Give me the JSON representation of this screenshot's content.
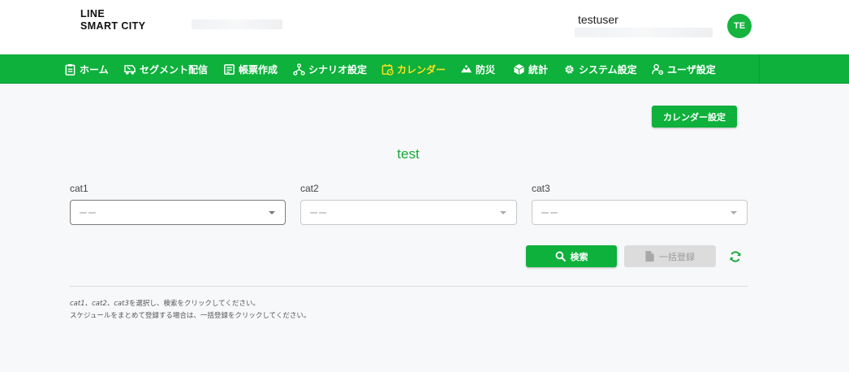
{
  "header": {
    "logo_line1": "LINE",
    "logo_line2": "SMART CITY",
    "username": "testuser",
    "avatar_initials": "TE"
  },
  "nav": {
    "items": [
      {
        "label": "ホーム",
        "icon": "clipboard-icon"
      },
      {
        "label": "セグメント配信",
        "icon": "send-icon"
      },
      {
        "label": "帳票作成",
        "icon": "form-icon"
      },
      {
        "label": "シナリオ設定",
        "icon": "scenario-icon"
      },
      {
        "label": "カレンダー",
        "icon": "calendar-icon",
        "active": true
      },
      {
        "label": "防災",
        "icon": "disaster-icon"
      },
      {
        "label": "統計",
        "icon": "cube-icon"
      },
      {
        "label": "システム設定",
        "icon": "gear-icon"
      },
      {
        "label": "ユーザ設定",
        "icon": "user-gear-icon"
      }
    ],
    "active_color": "#ffe11d",
    "background": "#0db13b"
  },
  "main": {
    "calendar_settings_label": "カレンダー設定",
    "title": "test",
    "fields": [
      {
        "label": "cat1",
        "value": "ーー"
      },
      {
        "label": "cat2",
        "value": "ーー"
      },
      {
        "label": "cat3",
        "value": "ーー"
      }
    ],
    "search_label": "検索",
    "bulk_register_label": "一括登録",
    "help_line1_cats": "cat1、cat2、cat3",
    "help_line1_rest": "を選択し、検索をクリックしてください。",
    "help_line2": "スケジュールをまとめて登録する場合は、一括登録をクリックしてください。"
  },
  "colors": {
    "accent": "#0db13b",
    "title": "#16a838",
    "disabled": "#dcdcdc"
  }
}
